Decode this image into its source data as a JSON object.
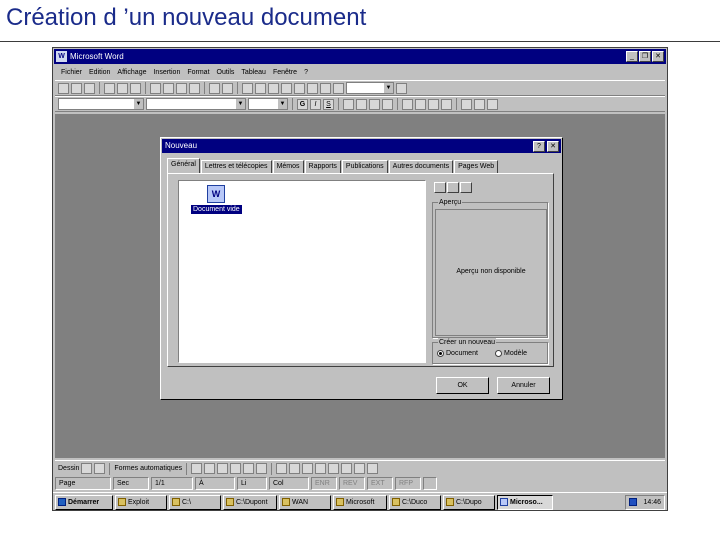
{
  "slide": {
    "title": "Création d ’un nouveau document"
  },
  "window": {
    "title": "Microsoft Word",
    "app_icon": "W",
    "controls": {
      "minimize": "_",
      "restore": "❐",
      "close": "✕"
    }
  },
  "menubar": [
    "Fichier",
    "Edition",
    "Affichage",
    "Insertion",
    "Format",
    "Outils",
    "Tableau",
    "Fenêtre",
    "?"
  ],
  "toolbar_standard": {
    "icons": [
      "new-icon",
      "open-icon",
      "save-icon",
      "print-icon",
      "preview-icon",
      "spelling-icon",
      "cut-icon",
      "copy-icon",
      "paste-icon",
      "format-painter-icon",
      "undo-icon",
      "redo-icon",
      "hyperlink-icon",
      "web-toolbar-icon",
      "table-icon",
      "excel-icon",
      "columns-icon",
      "drawing-icon",
      "map-icon",
      "paragraph-marks-icon",
      "zoom-combo",
      "help-icon"
    ],
    "zoom_value": ""
  },
  "toolbar_format": {
    "style_value": "",
    "font_value": "",
    "size_value": "",
    "bold": "G",
    "italic": "I",
    "underline": "S"
  },
  "dialog": {
    "title": "Nouveau",
    "help": "?",
    "close": "✕",
    "tabs": [
      "Général",
      "Lettres et télécopies",
      "Mémos",
      "Rapports",
      "Publications",
      "Autres documents",
      "Pages Web"
    ],
    "active_tab": 0,
    "file_item": {
      "label": "Document vide",
      "icon": "W"
    },
    "preview": {
      "legend": "Aperçu",
      "text": "Aperçu non disponible"
    },
    "create_new": {
      "legend": "Créer un nouveau",
      "options": [
        "Document",
        "Modèle"
      ],
      "selected": 0
    },
    "ok_label": "OK",
    "cancel_label": "Annuler"
  },
  "drawing_toolbar": {
    "draw_label": "Dessin",
    "autoshapes_label": "Formes automatiques"
  },
  "statusbar": {
    "page": "Page",
    "section": "Sec",
    "page_of": "1/1",
    "position": "À",
    "line": "Li",
    "col": "Col",
    "modes": [
      "ENR",
      "REV",
      "EXT",
      "RFP"
    ]
  },
  "taskbar": {
    "start_label": "Démarrer",
    "items": [
      "Exploit",
      "C:\\",
      "C:\\Dupont",
      "WAN",
      "Microsoft",
      "C:\\Duco",
      "C:\\Dupo",
      "Microso..."
    ],
    "active_index": 7,
    "clock": "14:46"
  }
}
